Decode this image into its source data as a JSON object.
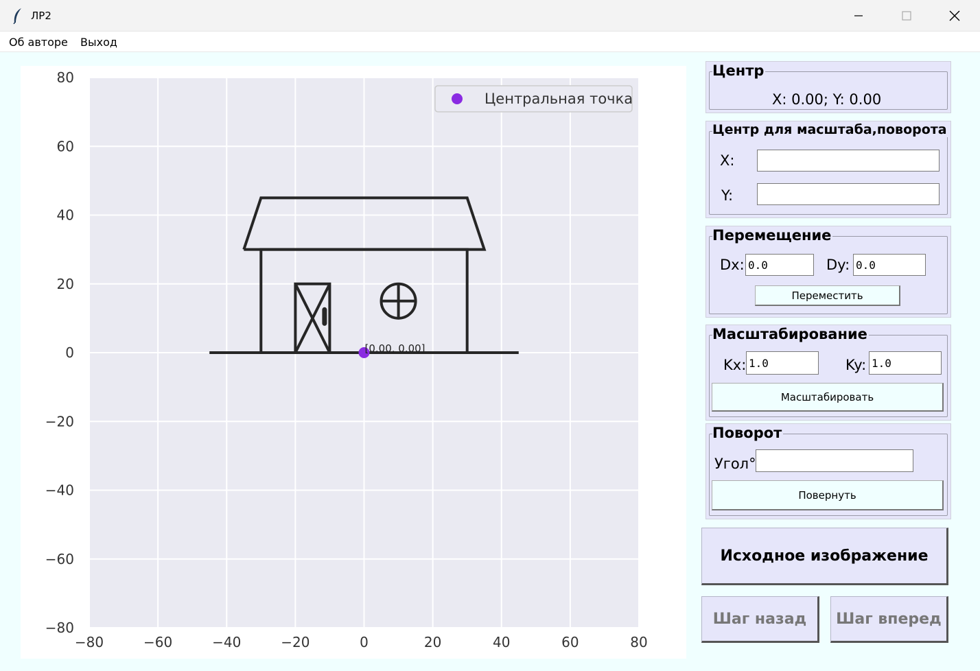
{
  "window": {
    "title": "ЛР2",
    "icon": "feather-icon"
  },
  "menu": {
    "about": "Об авторе",
    "exit": "Выход"
  },
  "center_panel": {
    "title": "Центр",
    "value": "X: 0.00; Y: 0.00"
  },
  "pivot_panel": {
    "title": "Центр для масштаба,поворота",
    "x_label": "X:",
    "y_label": "Y:",
    "x_value": "",
    "y_value": ""
  },
  "move_panel": {
    "title": "Перемещение",
    "dx_label": "Dx:",
    "dy_label": "Dy:",
    "dx_value": "0.0",
    "dy_value": "0.0",
    "button": "Переместить"
  },
  "scale_panel": {
    "title": "Масштабирование",
    "kx_label": "Kx:",
    "ky_label": "Ky:",
    "kx_value": "1.0",
    "ky_value": "1.0",
    "button": "Масштабировать"
  },
  "rotate_panel": {
    "title": "Поворот",
    "angle_label": "Угол°",
    "angle_value": "",
    "button": "Повернуть"
  },
  "actions": {
    "reset": "Исходное изображение",
    "undo": "Шаг назад",
    "redo": "Шаг вперед"
  },
  "colors": {
    "plot_bg": "#eaeaf2",
    "point": "#8a2be2",
    "panel": "#e6e6fa",
    "app_bg": "#f0ffff"
  },
  "chart_data": {
    "type": "line",
    "xlim": [
      -80,
      80
    ],
    "ylim": [
      -80,
      80
    ],
    "x_ticks": [
      "−80",
      "−60",
      "−40",
      "−20",
      "0",
      "20",
      "40",
      "60",
      "80"
    ],
    "y_ticks": [
      "80",
      "60",
      "40",
      "20",
      "0",
      "−20",
      "−40",
      "−60",
      "−80"
    ],
    "grid": true,
    "legend": {
      "label": "Центральная точка",
      "placement": "top-right"
    },
    "center_point": {
      "x": 0,
      "y": 0,
      "label": "[0.00, 0.00]"
    },
    "segments": [
      {
        "name": "ground",
        "points": [
          [
            -45,
            0
          ],
          [
            45,
            0
          ]
        ]
      },
      {
        "name": "house-walls",
        "points": [
          [
            -30,
            0
          ],
          [
            -30,
            30
          ],
          [
            30,
            30
          ],
          [
            30,
            0
          ]
        ]
      },
      {
        "name": "roof",
        "points": [
          [
            -35,
            30
          ],
          [
            -30,
            45
          ],
          [
            30,
            45
          ],
          [
            35,
            30
          ],
          [
            -35,
            30
          ]
        ]
      },
      {
        "name": "door-frame",
        "points": [
          [
            -20,
            0
          ],
          [
            -20,
            20
          ],
          [
            -10,
            20
          ],
          [
            -10,
            0
          ]
        ]
      },
      {
        "name": "door-cross-1",
        "points": [
          [
            -20,
            0
          ],
          [
            -10,
            20
          ]
        ]
      },
      {
        "name": "door-cross-2",
        "points": [
          [
            -20,
            20
          ],
          [
            -10,
            0
          ]
        ]
      },
      {
        "name": "window-cross-h",
        "points": [
          [
            5,
            15
          ],
          [
            15,
            15
          ]
        ]
      },
      {
        "name": "window-cross-v",
        "points": [
          [
            10,
            10
          ],
          [
            10,
            20
          ]
        ]
      },
      {
        "name": "door-handle",
        "points": [
          [
            -11.5,
            8.5
          ],
          [
            -11.5,
            12.5
          ]
        ]
      }
    ],
    "circles": [
      {
        "name": "window",
        "cx": 10,
        "cy": 15,
        "r": 5
      }
    ]
  }
}
